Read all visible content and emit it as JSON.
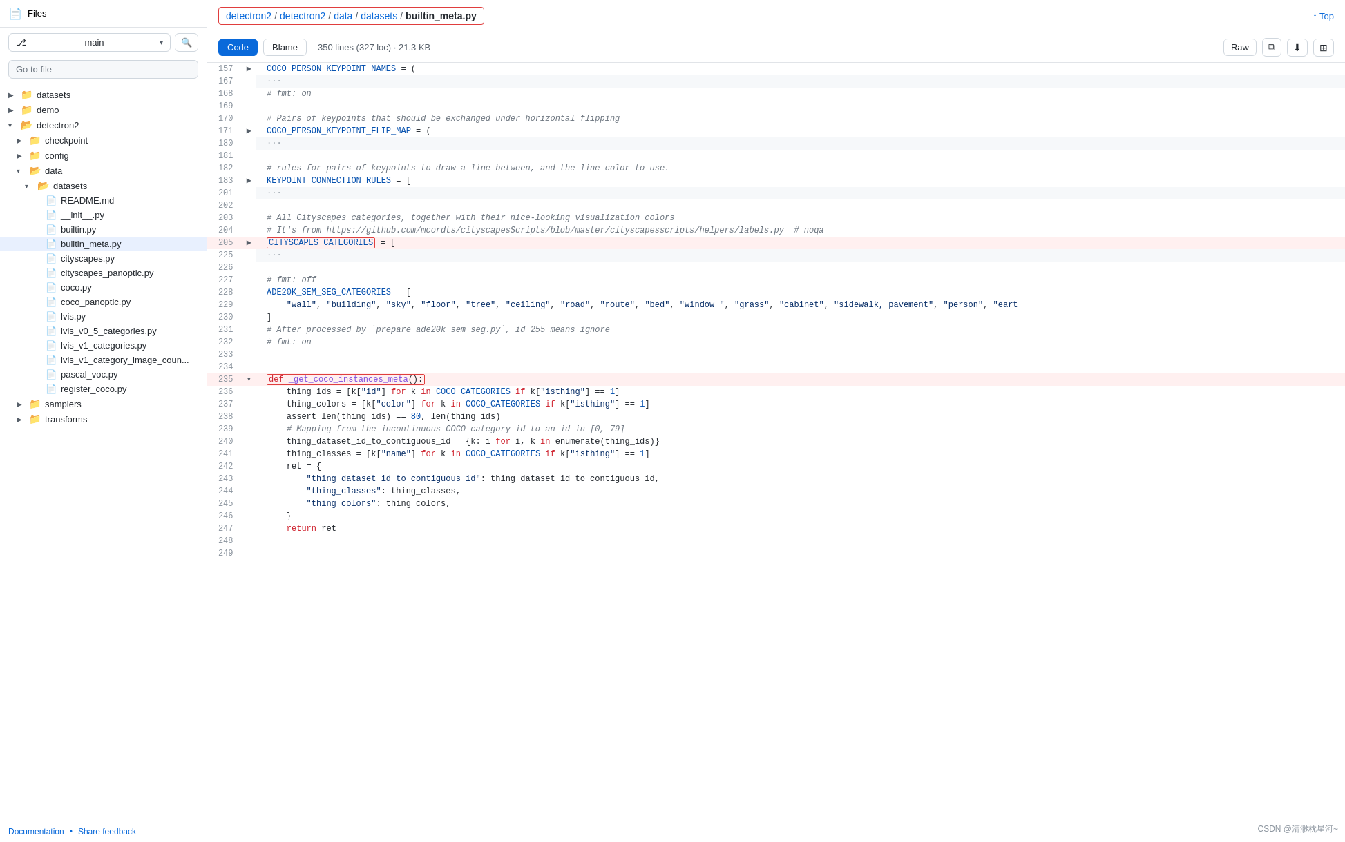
{
  "sidebar": {
    "title": "Files",
    "branch": "main",
    "search_placeholder": "Go to file",
    "items": [
      {
        "id": "datasets",
        "label": "datasets",
        "type": "folder",
        "indent": 0,
        "expanded": false
      },
      {
        "id": "demo",
        "label": "demo",
        "type": "folder",
        "indent": 0,
        "expanded": false
      },
      {
        "id": "detectron2",
        "label": "detectron2",
        "type": "folder",
        "indent": 0,
        "expanded": true
      },
      {
        "id": "checkpoint",
        "label": "checkpoint",
        "type": "folder",
        "indent": 1,
        "expanded": false
      },
      {
        "id": "config",
        "label": "config",
        "type": "folder",
        "indent": 1,
        "expanded": false
      },
      {
        "id": "data",
        "label": "data",
        "type": "folder",
        "indent": 1,
        "expanded": true
      },
      {
        "id": "data-datasets",
        "label": "datasets",
        "type": "folder",
        "indent": 2,
        "expanded": true
      },
      {
        "id": "readme",
        "label": "README.md",
        "type": "file",
        "indent": 3
      },
      {
        "id": "init",
        "label": "__init__.py",
        "type": "file",
        "indent": 3
      },
      {
        "id": "builtin",
        "label": "builtin.py",
        "type": "file",
        "indent": 3
      },
      {
        "id": "builtin_meta",
        "label": "builtin_meta.py",
        "type": "file",
        "indent": 3,
        "active": true
      },
      {
        "id": "cityscapes",
        "label": "cityscapes.py",
        "type": "file",
        "indent": 3
      },
      {
        "id": "cityscapes_panoptic",
        "label": "cityscapes_panoptic.py",
        "type": "file",
        "indent": 3
      },
      {
        "id": "coco",
        "label": "coco.py",
        "type": "file",
        "indent": 3
      },
      {
        "id": "coco_panoptic",
        "label": "coco_panoptic.py",
        "type": "file",
        "indent": 3
      },
      {
        "id": "lvis",
        "label": "lvis.py",
        "type": "file",
        "indent": 3
      },
      {
        "id": "lvis_v0",
        "label": "lvis_v0_5_categories.py",
        "type": "file",
        "indent": 3
      },
      {
        "id": "lvis_v1",
        "label": "lvis_v1_categories.py",
        "type": "file",
        "indent": 3
      },
      {
        "id": "lvis_v1_image",
        "label": "lvis_v1_category_image_coun...",
        "type": "file",
        "indent": 3
      },
      {
        "id": "pascal_voc",
        "label": "pascal_voc.py",
        "type": "file",
        "indent": 3
      },
      {
        "id": "register_coco",
        "label": "register_coco.py",
        "type": "file",
        "indent": 3
      },
      {
        "id": "samplers",
        "label": "samplers",
        "type": "folder",
        "indent": 1,
        "expanded": false
      },
      {
        "id": "transforms",
        "label": "transforms",
        "type": "folder",
        "indent": 1,
        "expanded": false
      }
    ],
    "footer": {
      "doc_label": "Documentation",
      "feedback_label": "Share feedback",
      "separator": "•"
    }
  },
  "breadcrumb": {
    "parts": [
      "detectron2",
      "detectron2",
      "data",
      "datasets",
      "builtin_meta.py"
    ],
    "separators": [
      "/",
      "/",
      "/",
      "/"
    ]
  },
  "top_btn": "↑ Top",
  "file_tabs": {
    "code_label": "Code",
    "blame_label": "Blame",
    "info": "350 lines (327 loc) · 21.3 KB"
  },
  "toolbar": {
    "raw_label": "Raw",
    "copy_icon": "⧉",
    "download_icon": "⬇",
    "settings_icon": "⊞"
  },
  "code_lines": [
    {
      "num": 157,
      "expand": true,
      "content": "COCO_PERSON_KEYPOINT_NAMES = (",
      "highlight": false
    },
    {
      "num": 167,
      "expand": false,
      "content": "···",
      "is_ellipsis": true
    },
    {
      "num": 168,
      "expand": false,
      "content": "# fmt: on",
      "is_comment": true
    },
    {
      "num": 169,
      "expand": false,
      "content": ""
    },
    {
      "num": 170,
      "expand": false,
      "content": "# Pairs of keypoints that should be exchanged under horizontal flipping",
      "is_comment": true
    },
    {
      "num": 171,
      "expand": true,
      "content": "COCO_PERSON_KEYPOINT_FLIP_MAP = (",
      "highlight": false
    },
    {
      "num": 180,
      "expand": false,
      "content": "···",
      "is_ellipsis": true
    },
    {
      "num": 181,
      "expand": false,
      "content": ""
    },
    {
      "num": 182,
      "expand": false,
      "content": "# rules for pairs of keypoints to draw a line between, and the line color to use.",
      "is_comment": true
    },
    {
      "num": 183,
      "expand": true,
      "content": "KEYPOINT_CONNECTION_RULES = [",
      "highlight": false
    },
    {
      "num": 201,
      "expand": false,
      "content": "···",
      "is_ellipsis": true
    },
    {
      "num": 202,
      "expand": false,
      "content": ""
    },
    {
      "num": 203,
      "expand": false,
      "content": "# All Cityscapes categories, together with their nice-looking visualization colors",
      "is_comment": true
    },
    {
      "num": 204,
      "expand": false,
      "content": "# It's from https://github.com/mcordts/cityscapesScripts/blob/master/cityscapesscripts/helpers/labels.py  # noqa",
      "is_comment": true
    },
    {
      "num": 205,
      "expand": true,
      "content": "CITYSCAPES_CATEGORIES = [",
      "highlight": true
    },
    {
      "num": 225,
      "expand": false,
      "content": "···",
      "is_ellipsis": true
    },
    {
      "num": 226,
      "expand": false,
      "content": ""
    },
    {
      "num": 227,
      "expand": false,
      "content": "# fmt: off",
      "is_comment": true
    },
    {
      "num": 228,
      "expand": false,
      "content": "ADE20K_SEM_SEG_CATEGORIES = ["
    },
    {
      "num": 229,
      "expand": false,
      "content": "    \"wall\", \"building\", \"sky\", \"floor\", \"tree\", \"ceiling\", \"road\", \"route\", \"bed\", \"window \", \"grass\", \"cabinet\", \"sidewalk, pavement\", \"person\", \"eart"
    },
    {
      "num": 230,
      "expand": false,
      "content": "]"
    },
    {
      "num": 231,
      "expand": false,
      "content": "# After processed by `prepare_ade20k_sem_seg.py`, id 255 means ignore",
      "is_comment": true
    },
    {
      "num": 232,
      "expand": false,
      "content": "# fmt: on",
      "is_comment": true
    },
    {
      "num": 233,
      "expand": false,
      "content": ""
    },
    {
      "num": 234,
      "expand": false,
      "content": ""
    },
    {
      "num": 235,
      "expand": true,
      "content": "def _get_coco_instances_meta():",
      "highlight": true,
      "is_def": true
    },
    {
      "num": 236,
      "expand": false,
      "content": "    thing_ids = [k[\"id\"] for k in COCO_CATEGORIES if k[\"isthing\"] == 1]"
    },
    {
      "num": 237,
      "expand": false,
      "content": "    thing_colors = [k[\"color\"] for k in COCO_CATEGORIES if k[\"isthing\"] == 1]"
    },
    {
      "num": 238,
      "expand": false,
      "content": "    assert len(thing_ids) == 80, len(thing_ids)"
    },
    {
      "num": 239,
      "expand": false,
      "content": "    # Mapping from the incontinuous COCO category id to an id in [0, 79]",
      "is_comment": true
    },
    {
      "num": 240,
      "expand": false,
      "content": "    thing_dataset_id_to_contiguous_id = {k: i for i, k in enumerate(thing_ids)}"
    },
    {
      "num": 241,
      "expand": false,
      "content": "    thing_classes = [k[\"name\"] for k in COCO_CATEGORIES if k[\"isthing\"] == 1]"
    },
    {
      "num": 242,
      "expand": false,
      "content": "    ret = {"
    },
    {
      "num": 243,
      "expand": false,
      "content": "        \"thing_dataset_id_to_contiguous_id\": thing_dataset_id_to_contiguous_id,"
    },
    {
      "num": 244,
      "expand": false,
      "content": "        \"thing_classes\": thing_classes,"
    },
    {
      "num": 245,
      "expand": false,
      "content": "        \"thing_colors\": thing_colors,"
    },
    {
      "num": 246,
      "expand": false,
      "content": "    }"
    },
    {
      "num": 247,
      "expand": false,
      "content": "    return ret",
      "is_return": true
    },
    {
      "num": 248,
      "expand": false,
      "content": ""
    },
    {
      "num": 249,
      "expand": false,
      "content": ""
    }
  ],
  "watermark": "CSDN @清渺枕星河~"
}
